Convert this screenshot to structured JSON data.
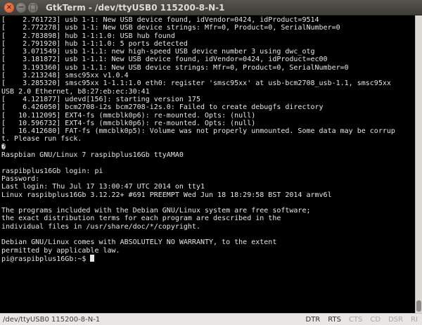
{
  "window": {
    "title": "GtkTerm - /dev/ttyUSB0  115200-8-N-1",
    "close_glyph": "×",
    "minimize_glyph": "−",
    "maximize_glyph": "□"
  },
  "terminal": {
    "lines": [
      "[    2.761723] usb 1-1: New USB device found, idVendor=0424, idProduct=9514",
      "[    2.772278] usb 1-1: New USB device strings: Mfr=0, Product=0, SerialNumber=0",
      "[    2.783898] hub 1-1:1.0: USB hub found",
      "[    2.791920] hub 1-1:1.0: 5 ports detected",
      "[    3.071549] usb 1-1.1: new high-speed USB device number 3 using dwc_otg",
      "[    3.181872] usb 1-1.1: New USB device found, idVendor=0424, idProduct=ec00",
      "[    3.193360] usb 1-1.1: New USB device strings: Mfr=0, Product=0, SerialNumber=0",
      "[    3.213248] smsc95xx v1.0.4",
      "[    3.285320] smsc95xx 1-1.1:1.0 eth0: register 'smsc95xx' at usb-bcm2708_usb-1.1, smsc95xx",
      "USB 2.0 Ethernet, b8:27:eb:ec:30:41",
      "[    4.121877] udevd[156]: starting version 175",
      "[    6.426050] bcm2708-i2s bcm2708-i2s.0: Failed to create debugfs directory",
      "[   10.112095] EXT4-fs (mmcblk0p6): re-mounted. Opts: (null)",
      "[   10.596732] EXT4-fs (mmcblk0p6): re-mounted. Opts: (null)",
      "[   16.412680] FAT-fs (mmcblk0p5): Volume was not properly unmounted. Some data may be corrup",
      "t. Please run fsck.",
      "�",
      "Raspbian GNU/Linux 7 raspibplus16Gb ttyAMA0",
      "",
      "raspibplus16Gb login: pi",
      "Password:",
      "Last login: Thu Jul 17 13:00:47 UTC 2014 on tty1",
      "Linux raspibplus16Gb 3.12.22+ #691 PREEMPT Wed Jun 18 18:29:58 BST 2014 armv6l",
      "",
      "The programs included with the Debian GNU/Linux system are free software;",
      "the exact distribution terms for each program are described in the",
      "individual files in /usr/share/doc/*/copyright.",
      "",
      "Debian GNU/Linux comes with ABSOLUTELY NO WARRANTY, to the extent",
      "permitted by applicable law."
    ],
    "prompt": "pi@raspibplus16Gb:~$ "
  },
  "statusbar": {
    "port": "/dev/ttyUSB0  115200-8-N-1",
    "signals": [
      {
        "label": "DTR",
        "active": true
      },
      {
        "label": "RTS",
        "active": true
      },
      {
        "label": "CTS",
        "active": false
      },
      {
        "label": "CD",
        "active": false
      },
      {
        "label": "DSR",
        "active": false
      },
      {
        "label": "RI",
        "active": false
      }
    ]
  }
}
